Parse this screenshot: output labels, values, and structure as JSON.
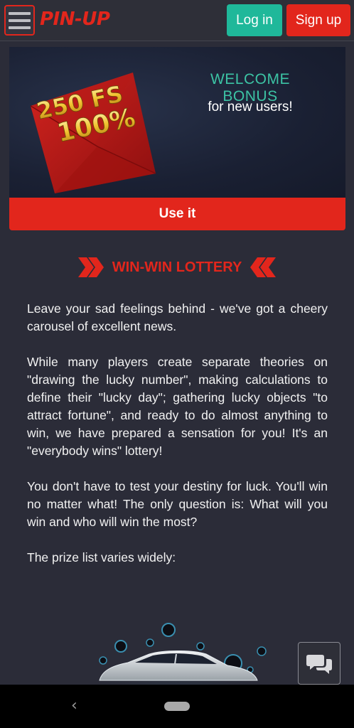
{
  "header": {
    "logo": "PIN-UP",
    "login_label": "Log in",
    "signup_label": "Sign up"
  },
  "banner": {
    "badge_line1": "250 FS",
    "badge_line2": "100%",
    "title": "WELCOME BONUS",
    "subtitle": "for new users!",
    "cta_label": "Use it"
  },
  "section": {
    "title": "WIN-WIN LOTTERY"
  },
  "article": {
    "paragraphs": [
      "Leave your sad feelings behind - we've got a cheery carousel of excellent news.",
      "While many players create separate theories on \"drawing the lucky number\", making calculations to define their \"lucky day\"; gathering lucky objects \"to attract fortune\", and ready to do almost anything to win, we have prepared a sensation for you! It's an \"everybody wins\" lottery!",
      "You don't have to test your destiny for luck. You'll win no matter what! The only question is: What will you win and who will win the most?",
      "The prize list varies widely:"
    ]
  },
  "colors": {
    "brand_red": "#e2261c",
    "accent_teal": "#1fb89a",
    "background": "#2b2c38"
  },
  "icons": {
    "menu": "hamburger-icon",
    "chat": "chat-bubbles-icon",
    "back": "back-icon",
    "home": "home-pill-icon"
  }
}
